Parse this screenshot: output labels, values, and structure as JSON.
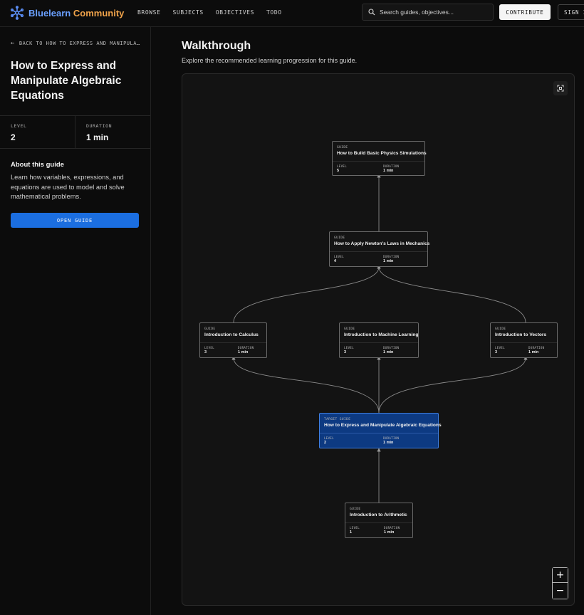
{
  "app": {
    "brand_part1": "Bluelearn",
    "brand_part2": "Community",
    "accent": "#1b6ee0",
    "brand_orange": "#f0a34a",
    "brand_blue": "#6aa0ff"
  },
  "nav": {
    "items": [
      "BROWSE",
      "SUBJECTS",
      "OBJECTIVES",
      "TODO"
    ]
  },
  "search": {
    "placeholder": "Search guides, objectives..."
  },
  "header_buttons": {
    "contribute": "CONTRIBUTE",
    "sign_in": "SIGN IN"
  },
  "sidebar": {
    "back_label": "BACK TO HOW TO EXPRESS AND MANIPULA…",
    "title": "How to Express and Manipulate Algebraic Equations",
    "level_label": "LEVEL",
    "level_value": "2",
    "duration_label": "DURATION",
    "duration_value": "1 min",
    "about_heading": "About this guide",
    "about_text": "Learn how variables, expressions, and equations are used to model and solve mathematical problems.",
    "open_button": "OPEN GUIDE"
  },
  "main": {
    "title": "Walkthrough",
    "subtitle": "Explore the recommended learning progression for this guide."
  },
  "graph": {
    "nodes": [
      {
        "type": "GUIDE",
        "title": "How to Build Basic Physics Simulations",
        "level_label": "LEVEL",
        "level": "5",
        "duration_label": "DURATION",
        "duration": "1 min",
        "target": false
      },
      {
        "type": "GUIDE",
        "title": "How to Apply Newton's Laws in Mechanics",
        "level_label": "LEVEL",
        "level": "4",
        "duration_label": "DURATION",
        "duration": "1 min",
        "target": false
      },
      {
        "type": "GUIDE",
        "title": "Introduction to Calculus",
        "level_label": "LEVEL",
        "level": "3",
        "duration_label": "DURATION",
        "duration": "1 min",
        "target": false
      },
      {
        "type": "GUIDE",
        "title": "Introduction to Machine Learning",
        "level_label": "LEVEL",
        "level": "3",
        "duration_label": "DURATION",
        "duration": "1 min",
        "target": false
      },
      {
        "type": "GUIDE",
        "title": "Introduction to Vectors",
        "level_label": "LEVEL",
        "level": "3",
        "duration_label": "DURATION",
        "duration": "1 min",
        "target": false
      },
      {
        "type": "TARGET GUIDE",
        "title": "How to Express and Manipulate Algebraic Equations",
        "level_label": "LEVEL",
        "level": "2",
        "duration_label": "DURATION",
        "duration": "1 min",
        "target": true
      },
      {
        "type": "GUIDE",
        "title": "Introduction to Arithmetic",
        "level_label": "LEVEL",
        "level": "1",
        "duration_label": "DURATION",
        "duration": "1 min",
        "target": false
      }
    ],
    "edges": [
      [
        6,
        5
      ],
      [
        5,
        2
      ],
      [
        5,
        3
      ],
      [
        5,
        4
      ],
      [
        2,
        1
      ],
      [
        4,
        1
      ],
      [
        1,
        0
      ]
    ]
  },
  "zoom": {
    "in": "+",
    "out": "−"
  }
}
